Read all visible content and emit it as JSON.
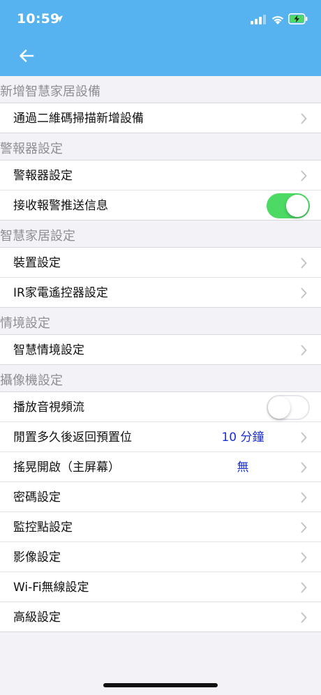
{
  "status_bar": {
    "time": "10:59"
  },
  "colors": {
    "header_bg": "#56b3f0",
    "toggle_on": "#4cd964",
    "value_text": "#1a2fd4"
  },
  "sections": [
    {
      "title": "新增智慧家居設備",
      "rows": [
        {
          "label": "通過二維碼掃描新增設備",
          "type": "nav"
        }
      ]
    },
    {
      "title": "警報器設定",
      "rows": [
        {
          "label": "警報器設定",
          "type": "nav"
        },
        {
          "label": "接收報警推送信息",
          "type": "toggle",
          "on": true
        }
      ]
    },
    {
      "title": "智慧家居設定",
      "rows": [
        {
          "label": "裝置設定",
          "type": "nav"
        },
        {
          "label": "IR家電遙控器設定",
          "type": "nav"
        }
      ]
    },
    {
      "title": "情境設定",
      "rows": [
        {
          "label": "智慧情境設定",
          "type": "nav"
        }
      ]
    },
    {
      "title": "攝像機設定",
      "rows": [
        {
          "label": "播放音視頻流",
          "type": "toggle",
          "on": false
        },
        {
          "label": "閒置多久後返回預置位",
          "type": "nav",
          "value": "10 分鐘"
        },
        {
          "label": "搖晃開啟（主屏幕）",
          "type": "nav",
          "value": "無"
        },
        {
          "label": "密碼設定",
          "type": "nav"
        },
        {
          "label": "監控點設定",
          "type": "nav"
        },
        {
          "label": "影像設定",
          "type": "nav"
        },
        {
          "label": "Wi-Fi無線設定",
          "type": "nav"
        },
        {
          "label": "高級設定",
          "type": "nav"
        }
      ]
    }
  ]
}
